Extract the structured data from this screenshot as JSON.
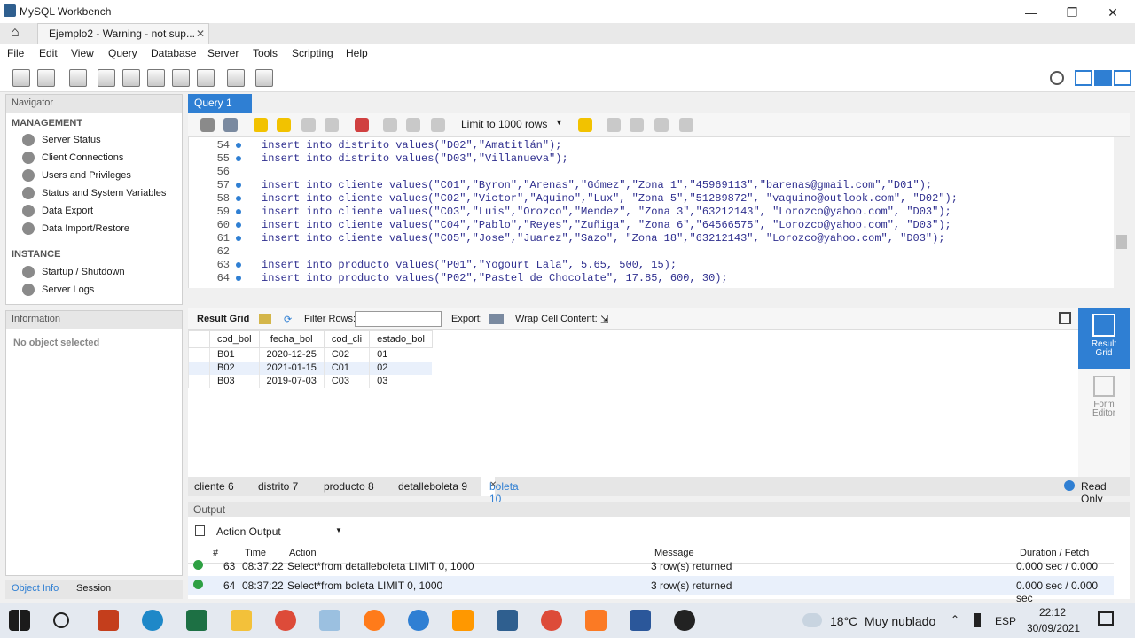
{
  "window": {
    "title": "MySQL Workbench"
  },
  "home_tab": {
    "label": "Ejemplo2 - Warning - not sup...",
    "close": "✕"
  },
  "menu": [
    "File",
    "Edit",
    "View",
    "Query",
    "Database",
    "Server",
    "Tools",
    "Scripting",
    "Help"
  ],
  "navigator": {
    "title": "Navigator",
    "management_label": "MANAGEMENT",
    "management_items": [
      "Server Status",
      "Client Connections",
      "Users and Privileges",
      "Status and System Variables",
      "Data Export",
      "Data Import/Restore"
    ],
    "instance_label": "INSTANCE",
    "instance_items": [
      "Startup / Shutdown",
      "Server Logs"
    ]
  },
  "information": {
    "title": "Information",
    "empty": "No object selected"
  },
  "left_tabs": {
    "object_info": "Object Info",
    "session": "Session"
  },
  "query_tab": {
    "label": "Query 1",
    "close": "✕"
  },
  "query_toolbar": {
    "limit": "Limit to 1000 rows"
  },
  "editor": {
    "lines": [
      {
        "num": "54",
        "text": "insert into distrito values(\"D02\",\"Amatitlán\");"
      },
      {
        "num": "55",
        "text": "insert into distrito values(\"D03\",\"Villanueva\");"
      },
      {
        "num": "56",
        "text": ""
      },
      {
        "num": "57",
        "text": "insert into cliente values(\"C01\",\"Byron\",\"Arenas\",\"Gómez\",\"Zona 1\",\"45969113\",\"barenas@gmail.com\",\"D01\");"
      },
      {
        "num": "58",
        "text": "insert into cliente values(\"C02\",\"Victor\",\"Aquino\",\"Lux\", \"Zona 5\",\"51289872\", \"vaquino@outlook.com\", \"D02\");"
      },
      {
        "num": "59",
        "text": "insert into cliente values(\"C03\",\"Luis\",\"Orozco\",\"Mendez\", \"Zona 3\",\"63212143\", \"Lorozco@yahoo.com\", \"D03\");"
      },
      {
        "num": "60",
        "text": "insert into cliente values(\"C04\",\"Pablo\",\"Reyes\",\"Zuñiga\", \"Zona 6\",\"64566575\", \"Lorozco@yahoo.com\", \"D03\");"
      },
      {
        "num": "61",
        "text": "insert into cliente values(\"C05\",\"Jose\",\"Juarez\",\"Sazo\", \"Zona 18\",\"63212143\", \"Lorozco@yahoo.com\", \"D03\");"
      },
      {
        "num": "62",
        "text": ""
      },
      {
        "num": "63",
        "text": "insert into producto values(\"P01\",\"Yogourt Lala\", 5.65, 500, 15);"
      },
      {
        "num": "64",
        "text": "insert into producto values(\"P02\",\"Pastel de Chocolate\", 17.85, 600, 30);"
      }
    ]
  },
  "result_bar": {
    "result_grid": "Result Grid",
    "filter_rows": "Filter Rows:",
    "export": "Export:",
    "wrap": "Wrap Cell Content:"
  },
  "grid": {
    "columns": [
      "cod_bol",
      "fecha_bol",
      "cod_cli",
      "estado_bol"
    ],
    "rows": [
      [
        "B01",
        "2020-12-25",
        "C02",
        "01"
      ],
      [
        "B02",
        "2021-01-15",
        "C01",
        "02"
      ],
      [
        "B03",
        "2019-07-03",
        "C03",
        "03"
      ]
    ]
  },
  "side_panel": {
    "result_grid": "Result Grid",
    "form_editor": "Form Editor"
  },
  "result_tabs": [
    "cliente 6",
    "distrito 7",
    "producto 8",
    "detalleboleta 9",
    "boleta 10"
  ],
  "read_only": "Read Only",
  "output": {
    "title": "Output",
    "selector": "Action Output",
    "headers": {
      "num": "#",
      "time": "Time",
      "action": "Action",
      "message": "Message",
      "duration": "Duration / Fetch"
    },
    "rows": [
      {
        "num": "63",
        "time": "08:37:22",
        "action": "Select*from detalleboleta LIMIT 0, 1000",
        "message": "3 row(s) returned",
        "duration": "0.000 sec / 0.000 sec"
      },
      {
        "num": "64",
        "time": "08:37:22",
        "action": "Select*from boleta LIMIT 0, 1000",
        "message": "3 row(s) returned",
        "duration": "0.000 sec / 0.000 sec"
      }
    ]
  },
  "taskbar": {
    "weather": "18°C  Muy nublado",
    "lang": "ESP",
    "time": "22:12",
    "date": "30/09/2021"
  },
  "colors": {
    "accent": "#2f7fd3"
  }
}
